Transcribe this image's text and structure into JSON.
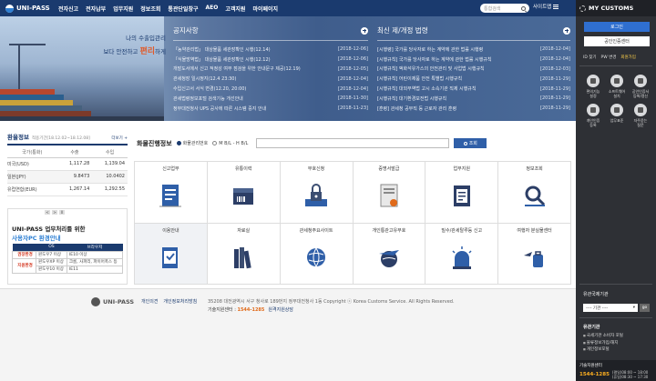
{
  "header": {
    "logo": "UNI-PASS",
    "nav": [
      "전자신고",
      "전자납부",
      "업무지원",
      "정보조회",
      "통관단일창구",
      "AEO",
      "고객지원",
      "마이페이지"
    ],
    "search_placeholder": "통합검색",
    "sitemap": "사이트맵"
  },
  "hero": {
    "slogan_line1": "나의 수출입관리",
    "slogan_pre": "보다 안전하고 ",
    "slogan_emph": "편리",
    "slogan_post": "하게"
  },
  "notices": {
    "title": "공지사항",
    "items": [
      {
        "text": "「농약관리법」 대상물품 세관장확인 시행(12.14)",
        "date": "[2018-12-06]"
      },
      {
        "text": "「식물방역법」 대상물품 세관장확인 시행(12.12)",
        "date": "[2018-12-06]"
      },
      {
        "text": "개발도서에서 신고 적정성 여부 점검을 위한 안내문구 제공(12.19)",
        "date": "[2018-12-05]"
      },
      {
        "text": "관세청장 일시정지(12.4 23:30)",
        "date": "[2018-12-04]"
      },
      {
        "text": "수입신고서 서식 변경(12.20, 20:00)",
        "date": "[2018-12-04]"
      },
      {
        "text": "관세법령정보포털 검색기능 개선안내",
        "date": "[2018-11-30]"
      },
      {
        "text": "정부대전청사 UPS 공사에 따른 시스템 중지 안내",
        "date": "[2018-11-23]"
      }
    ]
  },
  "regulations": {
    "title": "최신 제/개정 법령",
    "items": [
      {
        "text": "[시행령] 국가를 당사자로 하는 계약에 관한 법률 시행령",
        "date": "[2018-12-04]"
      },
      {
        "text": "[시행규칙] 국가를 당사자로 하는 계약에 관한 법률 시행규칙",
        "date": "[2018-12-04]"
      },
      {
        "text": "[시행규칙] 액화석유가스의 안전관리 및 사업법 시행규칙",
        "date": "[2018-12-03]"
      },
      {
        "text": "[시행규칙] 어린이제품 안전 특별법 시행규칙",
        "date": "[2018-11-29]"
      },
      {
        "text": "[시행규칙] 대외무역법 고시 소속기관 직제 시행규칙",
        "date": "[2018-11-29]"
      },
      {
        "text": "[시행규칙] 대기환경보전법 시행규칙",
        "date": "[2018-11-29]"
      },
      {
        "text": "[훈령] 관세청 공무직 등 근로자 관리 훈령",
        "date": "[2018-11-29]"
      }
    ]
  },
  "exchange": {
    "title": "환율정보",
    "period": "적용기간[18.12.02~18.12.08]",
    "more": "더보기 +",
    "headers": [
      "국가(통화)",
      "수출",
      "수입"
    ],
    "rows": [
      {
        "country": "미국(USD)",
        "export": "1,117.28",
        "import": "1,139.04"
      },
      {
        "country": "일본(JPY)",
        "export": "9.8473",
        "import": "10.0402"
      },
      {
        "country": "유럽연합(EUR)",
        "export": "1,267.14",
        "import": "1,292.55"
      }
    ]
  },
  "environment": {
    "pager": [
      "<",
      ">",
      "II"
    ],
    "title1": "UNI-PASS 업무처리를 위한",
    "title2": "사용자PC 환경안내",
    "headers": [
      "OS",
      "브라우저"
    ],
    "rows": [
      {
        "category": "권장환경",
        "os": "윈도우7 이상",
        "browser": "IE10 이상"
      },
      {
        "category": "지원환경",
        "os": "윈도우XP 이상",
        "browser": "크롬, 사파리, 파이어폭스 등"
      },
      {
        "category": "",
        "os": "윈도우10 이상",
        "browser": "IE11"
      }
    ]
  },
  "cargo": {
    "title": "화물진행정보",
    "option1": "화물관리번호",
    "option2": "M B/L - H B/L",
    "button": "조회"
  },
  "services": [
    {
      "label": "신고업무",
      "icon": "document-check-icon"
    },
    {
      "label": "유통이력",
      "icon": "box-barcode-icon"
    },
    {
      "label": "부호신청",
      "icon": "lock-laptop-icon"
    },
    {
      "label": "증명서발급",
      "icon": "certificate-icon"
    },
    {
      "label": "업무지원",
      "icon": "clipboard-icon"
    },
    {
      "label": "정보조회",
      "icon": "search-person-icon"
    },
    {
      "label": "이용안내",
      "icon": "guide-book-icon"
    },
    {
      "label": "자료실",
      "icon": "books-icon"
    },
    {
      "label": "관세청주요사이트",
      "icon": "globe-icon"
    },
    {
      "label": "개인통관고유부호",
      "icon": "globe-plane-icon"
    },
    {
      "label": "밀수/관세탈루등 신고",
      "icon": "siren-icon"
    },
    {
      "label": "여행자 분실물센터",
      "icon": "luggage-icon"
    }
  ],
  "footer": {
    "logo": "UNI-PASS",
    "links": [
      "개인의견",
      "개인정보처리방침"
    ],
    "address": "35208 대전광역시 서구 청사로 189번지 정부대전청사 1동   Copyright ⓒ Korea Customs Service. All Rights Reserved.",
    "call_label": "기술지원센터 : ",
    "call_number": "1544-1285",
    "remote": "원격지원상담"
  },
  "sidebar": {
    "title": "MY CUSTOMS",
    "login": "로그인",
    "cert": "공인인증센터",
    "links": [
      "ID 찾기",
      "PW 변경",
      "회원가입"
    ],
    "quick": [
      {
        "label": "편의기능\n설정"
      },
      {
        "label": "소프트웨어\n설치"
      },
      {
        "label": "공인인증서\n등록/갱신"
      },
      {
        "label": "개인인증\n등록"
      },
      {
        "label": "업무표준"
      },
      {
        "label": "자주묻는\n질문"
      }
    ],
    "org_title": "유관국제기관",
    "org_select": "---- 기관 ----",
    "org_go": "go",
    "related_title": "유관기관",
    "related": [
      "국세기관 소비자 포털",
      "물류정보가입/해지",
      "개인정보포털"
    ],
    "help_title": "기술지원센터",
    "help_number": "1544-1285",
    "help_hours1": "(평일)08:00 ~ 18:00",
    "help_hours2": "(휴일)08:30 ~ 17:30"
  }
}
